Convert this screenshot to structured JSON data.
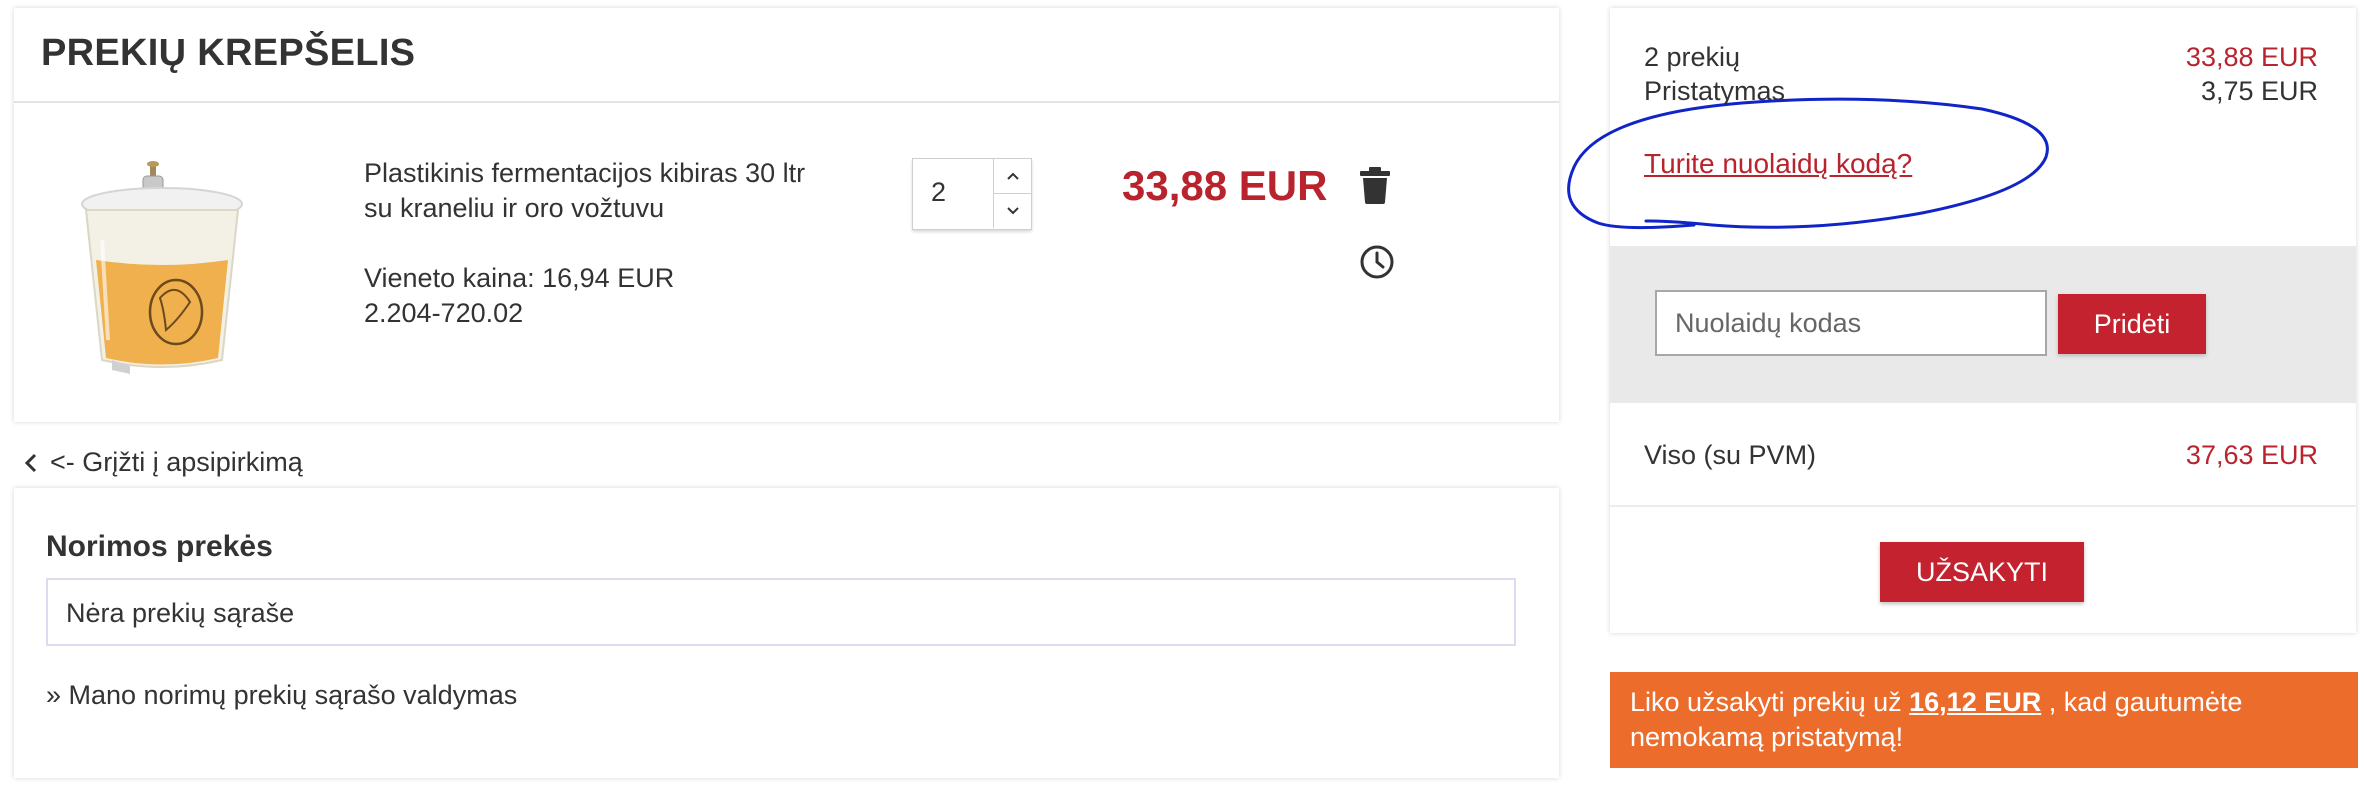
{
  "cart": {
    "title": "PREKIŲ KREPŠELIS",
    "item": {
      "name": "Plastikinis fermentacijos kibiras 30 ltr su kraneliu ir oro vožtuvu",
      "unit_price_label": "Vieneto kaina: 16,94 EUR",
      "sku": "2.204-720.02",
      "quantity": "2",
      "line_total": "33,88 EUR"
    },
    "back_link": "<- Grįžti į apsipirkimą"
  },
  "wishlist": {
    "title": "Norimos prekės",
    "empty_text": "Nėra prekių sąraše",
    "manage_link": "» Mano norimų prekių sąrašo valdymas"
  },
  "summary": {
    "items_label": "2 prekių",
    "items_total": "33,88 EUR",
    "shipping_label": "Pristatymas",
    "shipping_value": "3,75 EUR",
    "discount_link": "Turite nuolaidų kodą?",
    "discount_placeholder": "Nuolaidų kodas",
    "add_button": "Pridėti",
    "total_label": "Viso (su PVM)",
    "total_value": "37,63 EUR",
    "order_button": "UŽSAKYTI"
  },
  "free_shipping_banner": {
    "prefix": "Liko užsakyti prekių už",
    "amount": "16,12 EUR",
    "suffix": ", kad gautumėte nemokamą pristatymą!"
  },
  "icons": {
    "qty_up": "chevron-up-icon",
    "qty_down": "chevron-down-icon",
    "delete": "trash-icon",
    "save_for_later": "clock-icon",
    "back": "chevron-left-icon"
  },
  "colors": {
    "accent_red": "#c4222e",
    "price_red": "#b8232e",
    "banner_orange": "#ec6c2c",
    "annotation_blue": "#1024c8"
  }
}
